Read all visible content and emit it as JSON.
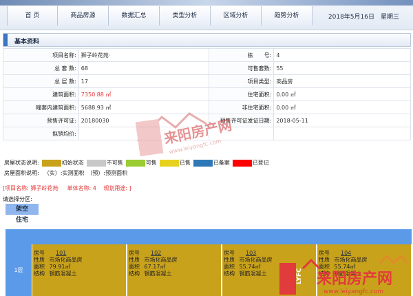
{
  "nav": {
    "tabs": [
      "首 页",
      "商品房源",
      "数据汇总",
      "类型分析",
      "区域分析",
      "趋势分析"
    ],
    "date": "2018年5月16日　星期三"
  },
  "section": {
    "title": "基本资料"
  },
  "info": {
    "rows": [
      [
        {
          "label": "项目名称:",
          "value": "狮子岭花苑·"
        },
        {
          "label": "栋　　号:",
          "value": "4"
        }
      ],
      [
        {
          "label": "总 套 数:",
          "value": "68"
        },
        {
          "label": "可售套数:",
          "value": "55"
        }
      ],
      [
        {
          "label": "总 层 数:",
          "value": "17"
        },
        {
          "label": "项目类型:",
          "value": "商品房"
        }
      ],
      [
        {
          "label": "建筑面积:",
          "value": "7350.88 ㎡",
          "red": true
        },
        {
          "label": "住宅面积:",
          "value": "0.00 ㎡"
        }
      ],
      [
        {
          "label": "幢套内建筑面积:",
          "value": "5688.93 ㎡"
        },
        {
          "label": "非住宅面积:",
          "value": "0.00 ㎡"
        }
      ],
      [
        {
          "label": "预售许可证:",
          "value": "20180030"
        },
        {
          "label": "预售许可证发证日期:",
          "value": "2018-05-11"
        }
      ],
      [
        {
          "label": "拟销均价:",
          "value": ""
        }
      ]
    ]
  },
  "watermark": {
    "brand": "来阳房产网",
    "domain": "www.leiyangfc.com"
  },
  "legend": {
    "status_label": "房屋状态说明:",
    "status_items": [
      {
        "label": "初始状态",
        "color": "#c9a21b"
      },
      {
        "label": "不可售",
        "color": "#c8c8c8"
      },
      {
        "label": "可售",
        "color": "#9acd32"
      },
      {
        "label": "已售",
        "color": "#e6d21e"
      },
      {
        "label": "已备案",
        "color": "#2e78b8"
      },
      {
        "label": "已登记",
        "color": "#ff0000"
      }
    ],
    "area_label": "房屋面积说明:",
    "area_text": "（实）:实测面积　（预）:预测面积"
  },
  "project_line": {
    "name": "[项目名称: 狮子岭花苑·",
    "unit": "单体名称: 4",
    "plan": "规划用途: ]"
  },
  "zone": {
    "label": "请选择分区:",
    "buttons": [
      "架空",
      "住宅"
    ]
  },
  "floor": {
    "label": "1层",
    "units": [
      {
        "no": "101",
        "nature": "市场化商品房",
        "area": "79.91㎡",
        "structure": "钢筋混凝土"
      },
      {
        "no": "102",
        "nature": "市场化商品房",
        "area": "67.17㎡",
        "structure": "钢筋混凝土"
      },
      {
        "no": "103",
        "nature": "市场化商品房",
        "area": "55.74㎡",
        "structure": "钢筋混凝土"
      },
      {
        "no": "104",
        "nature": "市场化商品房",
        "area": "55.74㎡",
        "structure": "钢筋混凝土"
      }
    ],
    "keys": {
      "no": "房号",
      "nature": "性质",
      "area": "面积",
      "structure": "结构"
    }
  },
  "corner": {
    "brand": "来阳房产网",
    "domain": "www.leiyangfc.com",
    "badge": "LYFC"
  }
}
